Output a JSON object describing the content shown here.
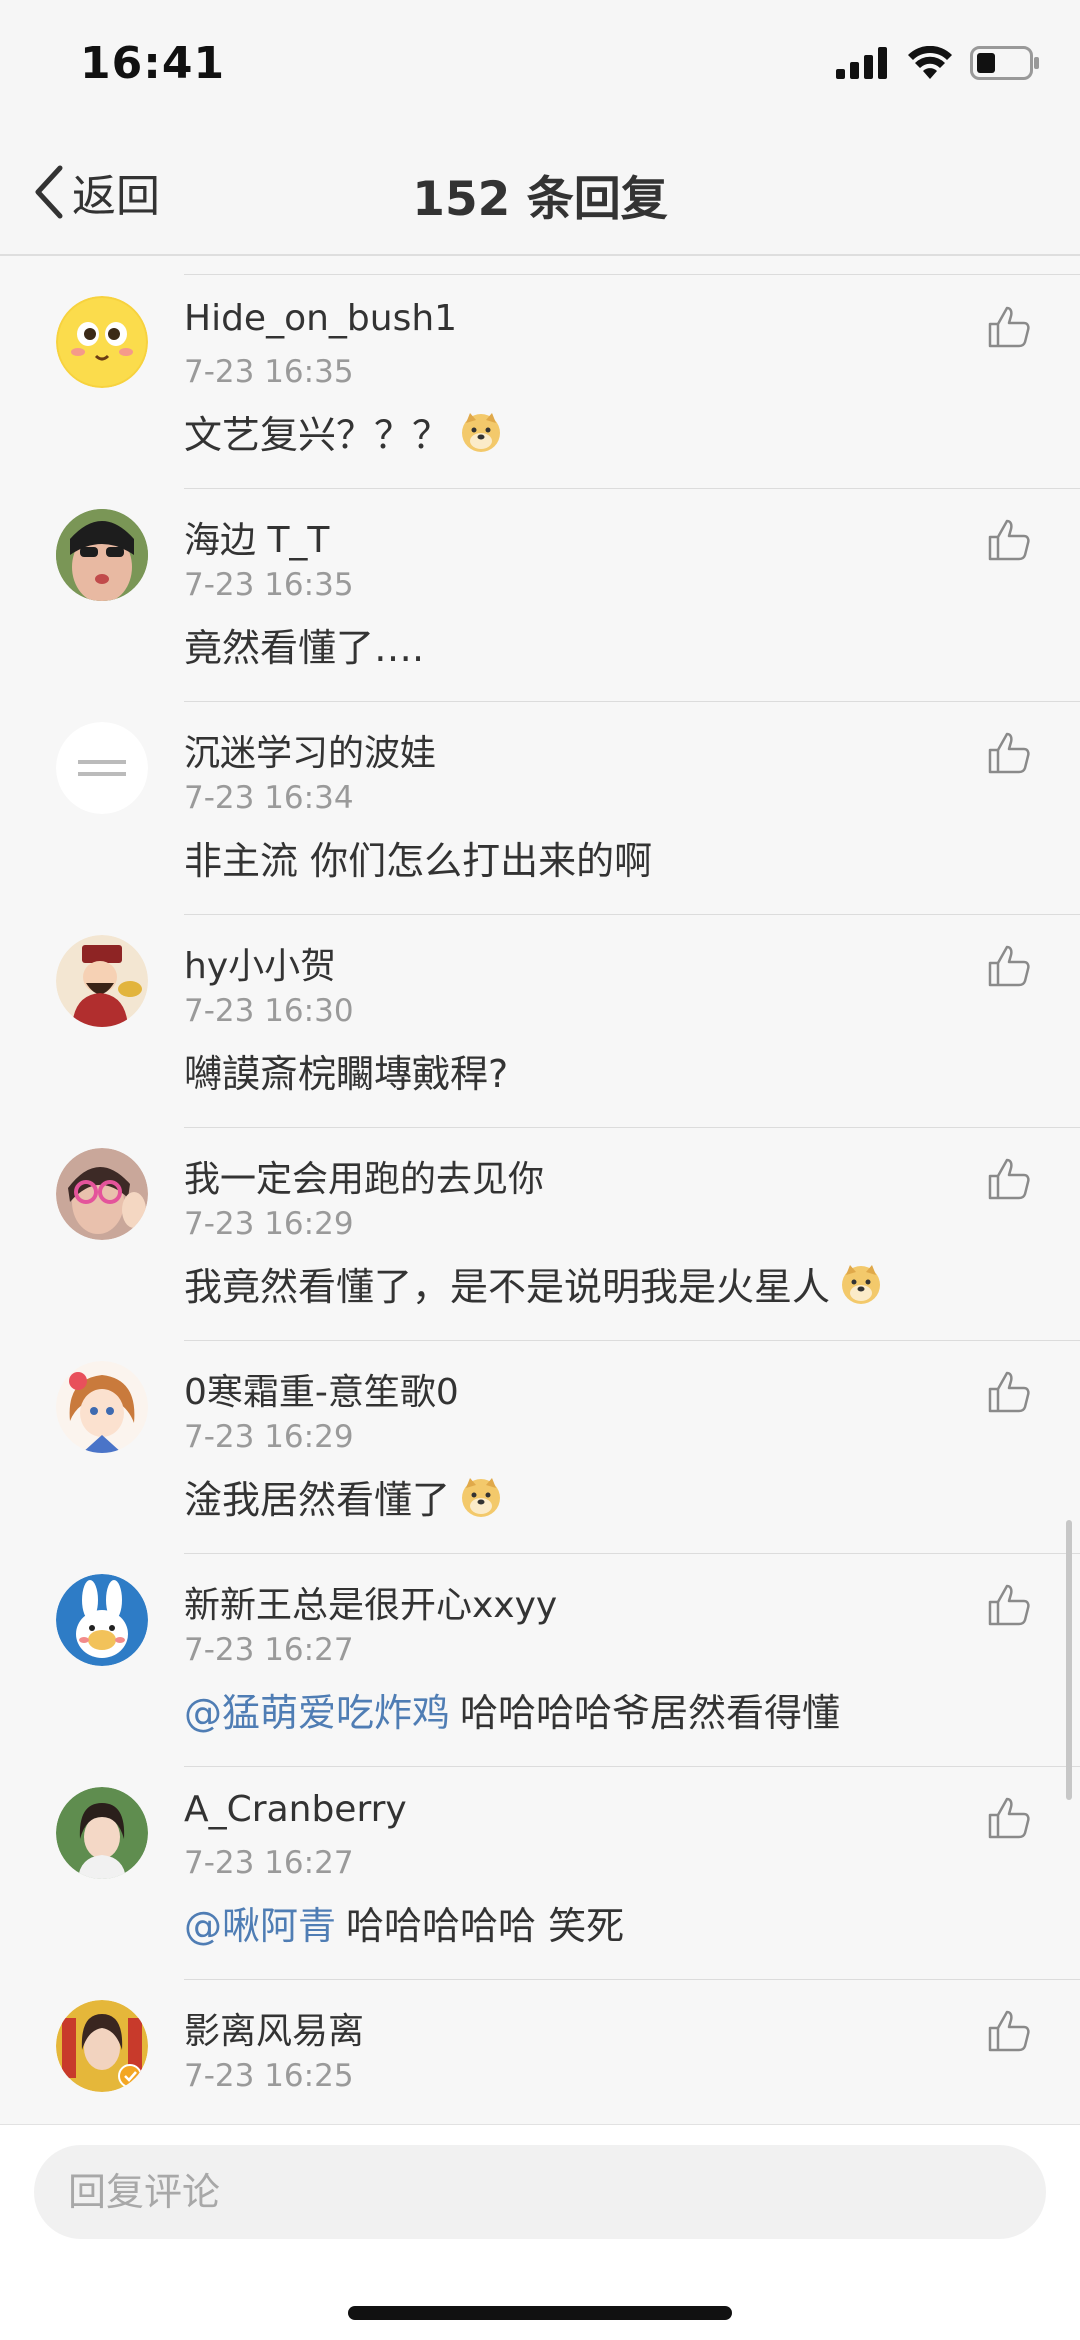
{
  "status_bar": {
    "time": "16:41",
    "icons": [
      "signal-icon",
      "wifi-icon",
      "battery-icon"
    ]
  },
  "nav": {
    "back_label": "返回",
    "title": "152 条回复"
  },
  "comments": [
    {
      "username": "Hide_on_bush1",
      "time": "7-23 16:35",
      "mention": "",
      "text": "文艺复兴？？？",
      "emoji": "doge-emoji",
      "avatar": "yellow-emoji-face"
    },
    {
      "username": "海边 T_T",
      "time": "7-23 16:35",
      "mention": "",
      "text": "竟然看懂了….",
      "emoji": "",
      "avatar": "person-photo"
    },
    {
      "username": "沉迷学习的波娃",
      "time": "7-23 16:34",
      "mention": "",
      "text": "非主流 你们怎么打出来的啊",
      "emoji": "",
      "avatar": "white-text-avatar"
    },
    {
      "username": "hy小小贺",
      "time": "7-23 16:30",
      "mention": "",
      "text": "嚩謨斎梡矙塼戭稈?",
      "emoji": "",
      "avatar": "cartoon-official"
    },
    {
      "username": "我一定会用跑的去见你",
      "time": "7-23 16:29",
      "mention": "",
      "text": "我竟然看懂了，是不是说明我是火星人",
      "emoji": "doge-emoji",
      "avatar": "person-with-glasses"
    },
    {
      "username": "0寒霜重-意笙歌0",
      "time": "7-23 16:29",
      "mention": "",
      "text": "淦我居然看懂了",
      "emoji": "doge-emoji",
      "avatar": "anime-girl"
    },
    {
      "username": "新新王总是很开心xxyy",
      "time": "7-23 16:27",
      "mention": "@猛萌爱吃炸鸡",
      "text": "哈哈哈哈爷居然看得懂",
      "emoji": "",
      "avatar": "bunny-plush"
    },
    {
      "username": "A_Cranberry",
      "time": "7-23 16:27",
      "mention": "@啾阿青",
      "text": "哈哈哈哈哈 笑死",
      "emoji": "",
      "avatar": "girl-photo"
    },
    {
      "username": "影离风易离",
      "time": "7-23 16:25",
      "mention": "",
      "text": "",
      "emoji": "",
      "avatar": "verified-person"
    }
  ],
  "reply_bar": {
    "placeholder": "回复评论"
  },
  "colors": {
    "mention": "#4f7db4",
    "timestamp": "#9a9a9a",
    "background": "#f7f7f7"
  }
}
